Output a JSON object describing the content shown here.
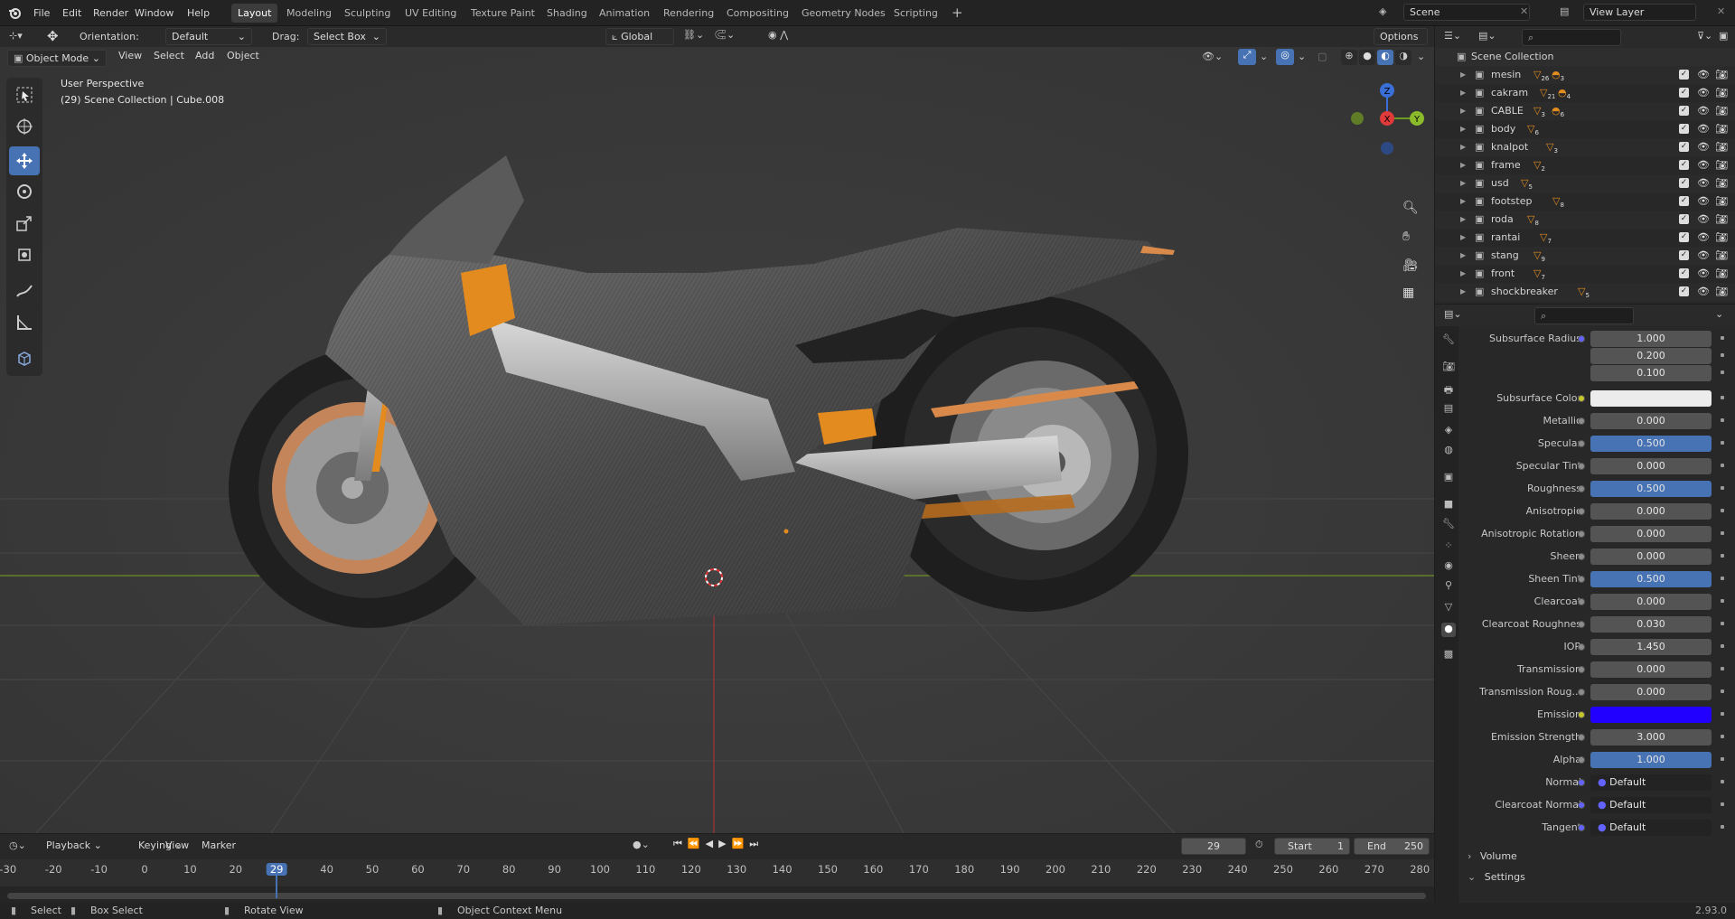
{
  "app": {
    "version": "2.93.0"
  },
  "topbar": {
    "menus": [
      "File",
      "Edit",
      "Render",
      "Window",
      "Help"
    ],
    "workspaces": [
      "Layout",
      "Modeling",
      "Sculpting",
      "UV Editing",
      "Texture Paint",
      "Shading",
      "Animation",
      "Rendering",
      "Compositing",
      "Geometry Nodes",
      "Scripting"
    ],
    "active_workspace": "Layout",
    "scene": "Scene",
    "view_layer": "View Layer"
  },
  "viewport_header": {
    "orientation_label": "Orientation:",
    "orientation_value": "Default",
    "drag_label": "Drag:",
    "drag_value": "Select Box",
    "transform_orientation": "Global",
    "options": "Options",
    "mode": "Object Mode",
    "menus": [
      "View",
      "Select",
      "Add",
      "Object"
    ]
  },
  "viewport": {
    "perspective": "User Perspective",
    "collection_info": "(29) Scene Collection | Cube.008",
    "gizmo": {
      "x": "X",
      "y": "Y",
      "z": "Z"
    }
  },
  "outliner": {
    "root": "Scene Collection",
    "items": [
      {
        "name": "mesin",
        "badge": "26",
        "badge2": "3"
      },
      {
        "name": "cakram",
        "badge": "21",
        "badge2": "4"
      },
      {
        "name": "CABLE",
        "badge": "3",
        "badge2": "6"
      },
      {
        "name": "body",
        "badge": "6",
        "badge2": ""
      },
      {
        "name": "knalpot",
        "badge": "3",
        "badge2": ""
      },
      {
        "name": "frame",
        "badge": "2",
        "badge2": ""
      },
      {
        "name": "usd",
        "badge": "5",
        "badge2": ""
      },
      {
        "name": "footstep",
        "badge": "8",
        "badge2": ""
      },
      {
        "name": "roda",
        "badge": "8",
        "badge2": ""
      },
      {
        "name": "rantai",
        "badge": "7",
        "badge2": ""
      },
      {
        "name": "stang",
        "badge": "9",
        "badge2": ""
      },
      {
        "name": "front",
        "badge": "7",
        "badge2": ""
      },
      {
        "name": "shockbreaker",
        "badge": "5",
        "badge2": ""
      }
    ]
  },
  "properties": {
    "rows": [
      {
        "label": "Subsurface Radius",
        "value": "1.000",
        "dot": "b",
        "style": "normal"
      },
      {
        "label": "",
        "value": "0.200",
        "dot": "",
        "style": "normal"
      },
      {
        "label": "",
        "value": "0.100",
        "dot": "",
        "style": "normal"
      },
      {
        "label": "Subsurface Color",
        "value": "",
        "dot": "y",
        "style": "white"
      },
      {
        "label": "Metallic",
        "value": "0.000",
        "dot": "g",
        "style": "normal"
      },
      {
        "label": "Specular",
        "value": "0.500",
        "dot": "g",
        "style": "sel"
      },
      {
        "label": "Specular Tint",
        "value": "0.000",
        "dot": "g",
        "style": "normal"
      },
      {
        "label": "Roughness",
        "value": "0.500",
        "dot": "g",
        "style": "sel"
      },
      {
        "label": "Anisotropic",
        "value": "0.000",
        "dot": "g",
        "style": "normal"
      },
      {
        "label": "Anisotropic Rotation",
        "value": "0.000",
        "dot": "g",
        "style": "normal"
      },
      {
        "label": "Sheen",
        "value": "0.000",
        "dot": "g",
        "style": "normal"
      },
      {
        "label": "Sheen Tint",
        "value": "0.500",
        "dot": "g",
        "style": "sel"
      },
      {
        "label": "Clearcoat",
        "value": "0.000",
        "dot": "g",
        "style": "normal"
      },
      {
        "label": "Clearcoat Roughnes",
        "value": "0.030",
        "dot": "g",
        "style": "normal"
      },
      {
        "label": "IOR",
        "value": "1.450",
        "dot": "g",
        "style": "normal"
      },
      {
        "label": "Transmission",
        "value": "0.000",
        "dot": "g",
        "style": "normal"
      },
      {
        "label": "Transmission Roug...",
        "value": "0.000",
        "dot": "g",
        "style": "normal"
      },
      {
        "label": "Emission",
        "value": "",
        "dot": "y",
        "style": "blue"
      },
      {
        "label": "Emission Strength",
        "value": "3.000",
        "dot": "g",
        "style": "normal"
      },
      {
        "label": "Alpha",
        "value": "1.000",
        "dot": "g",
        "style": "sel"
      },
      {
        "label": "Normal",
        "value": "Default",
        "dot": "b",
        "style": "dark"
      },
      {
        "label": "Clearcoat Normal",
        "value": "Default",
        "dot": "b",
        "style": "dark"
      },
      {
        "label": "Tangent",
        "value": "Default",
        "dot": "b",
        "style": "dark"
      }
    ],
    "panels": [
      "Volume",
      "Settings"
    ]
  },
  "timeline": {
    "menus": [
      "Playback",
      "Keying",
      "View",
      "Marker"
    ],
    "current_frame": "29",
    "start_label": "Start",
    "start": "1",
    "end_label": "End",
    "end": "250",
    "ticks": [
      "-30",
      "-20",
      "-10",
      "0",
      "10",
      "20",
      "29",
      "40",
      "50",
      "60",
      "70",
      "80",
      "90",
      "100",
      "110",
      "120",
      "130",
      "140",
      "150",
      "160",
      "170",
      "180",
      "190",
      "200",
      "210",
      "220",
      "230",
      "240",
      "250",
      "260",
      "270",
      "280"
    ]
  },
  "statusbar": {
    "select": "Select",
    "box_select": "Box Select",
    "rotate": "Rotate View",
    "context": "Object Context Menu",
    "version": "2.93.0"
  },
  "colors": {
    "accent": "#4772b3",
    "emission": "#2200ff",
    "orange": "#e38b1f"
  }
}
